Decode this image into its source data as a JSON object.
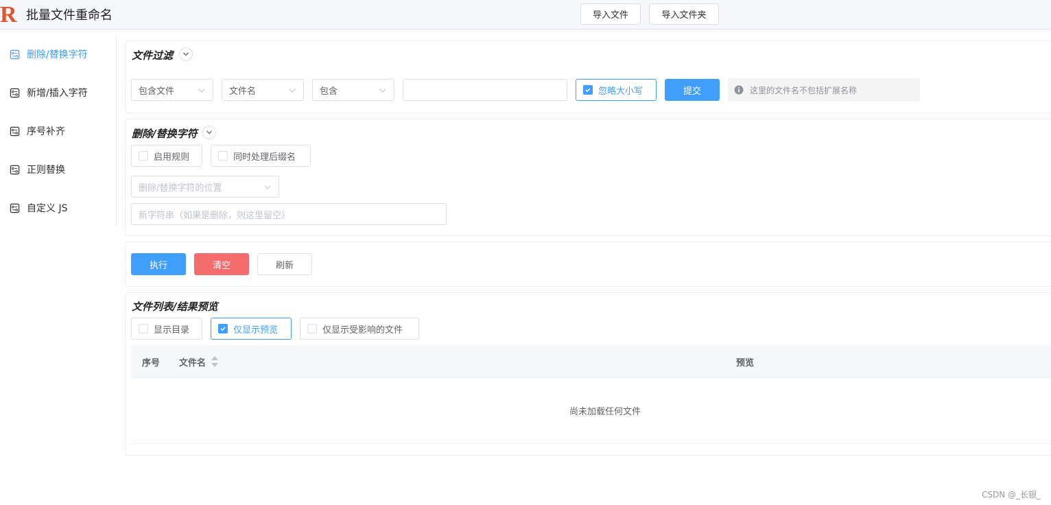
{
  "app": {
    "title": "批量文件重命名",
    "logo_letter": "R",
    "logo_color": "#e0552f"
  },
  "toolbar": {
    "import_file": "导入文件",
    "import_folder": "导入文件夹"
  },
  "sidebar": {
    "items": [
      {
        "label": "删除/替换字符",
        "active": true
      },
      {
        "label": "新增/插入字符",
        "active": false
      },
      {
        "label": "序号补齐",
        "active": false
      },
      {
        "label": "正则替换",
        "active": false
      },
      {
        "label": "自定义 JS",
        "active": false
      }
    ]
  },
  "filter": {
    "title": "文件过滤",
    "scope_select": "包含文件",
    "field_select": "文件名",
    "op_select": "包含",
    "value_input": "",
    "ignore_case": {
      "label": "忽略大小写",
      "checked": true
    },
    "submit": "提交",
    "hint": "这里的文件名不包括扩展名称"
  },
  "replace": {
    "title": "删除/替换字符",
    "enable_rule": {
      "label": "启用规则",
      "checked": false
    },
    "process_ext": {
      "label": "同时处理后缀名",
      "checked": false
    },
    "position_placeholder": "删除/替换字符的位置",
    "new_string_placeholder": "新字符串（如果是删除，则这里留空）"
  },
  "actions": {
    "execute": "执行",
    "clear": "清空",
    "refresh": "刷新"
  },
  "files": {
    "title": "文件列表/结果预览",
    "show_dirs": {
      "label": "显示目录",
      "checked": false
    },
    "preview_only": {
      "label": "仅显示预览",
      "checked": true
    },
    "affected_only": {
      "label": "仅显示受影响的文件",
      "checked": false
    },
    "columns": {
      "index": "序号",
      "name": "文件名",
      "preview": "预览"
    },
    "empty_text": "尚未加载任何文件"
  },
  "watermark": "CSDN @_长银_",
  "colors": {
    "primary": "#409eff",
    "danger": "#f56c6c"
  }
}
